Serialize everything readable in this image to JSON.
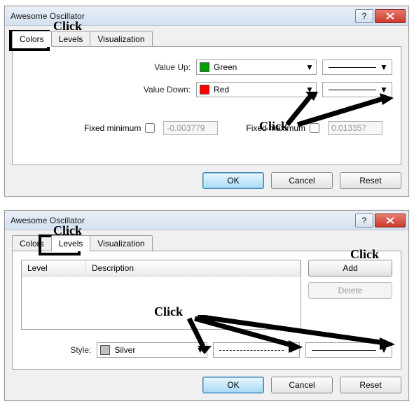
{
  "dialog1": {
    "title": "Awesome Oscillator",
    "tabs": {
      "colors": "Colors",
      "levels": "Levels",
      "visualization": "Visualization"
    },
    "value_up_label": "Value Up:",
    "value_up_color_name": "Green",
    "value_up_color_hex": "#00a000",
    "value_down_label": "Value Down:",
    "value_down_color_name": "Red",
    "value_down_color_hex": "#ff0000",
    "fixed_min_label": "Fixed minimum",
    "fixed_min_value": "-0.003779",
    "fixed_max_label": "Fixed maximum",
    "fixed_max_value": "0.013357",
    "ok": "OK",
    "cancel": "Cancel",
    "reset": "Reset"
  },
  "dialog2": {
    "title": "Awesome Oscillator",
    "tabs": {
      "colors": "Colors",
      "levels": "Levels",
      "visualization": "Visualization"
    },
    "col_level": "Level",
    "col_description": "Description",
    "add": "Add",
    "delete": "Delete",
    "style_label": "Style:",
    "style_color_name": "Silver",
    "style_color_hex": "#c0c0c0",
    "ok": "OK",
    "cancel": "Cancel",
    "reset": "Reset"
  },
  "annotations": {
    "click1": "Click",
    "click2": "Click",
    "click3": "Click",
    "click4": "Click",
    "click5": "Click"
  }
}
